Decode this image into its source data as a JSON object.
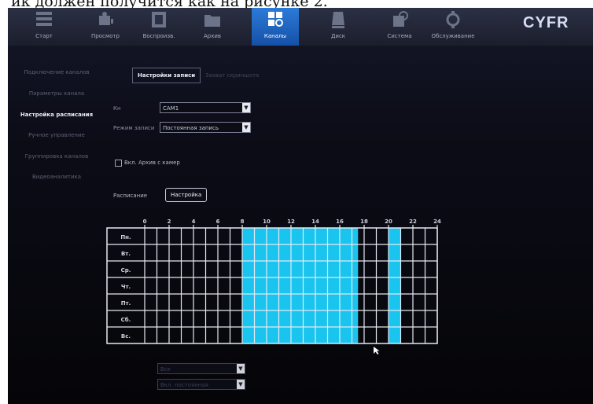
{
  "caption": "ик должен получится как на рисунке 2.",
  "brand": "CYFR",
  "menu": [
    {
      "label": "Старт",
      "icon": "start-icon",
      "active": false
    },
    {
      "label": "Просмотр",
      "icon": "view-icon",
      "active": false
    },
    {
      "label": "Воспроизв.",
      "icon": "playback-icon",
      "active": false
    },
    {
      "label": "Архив",
      "icon": "archive-icon",
      "active": false
    },
    {
      "label": "Каналы",
      "icon": "channels-icon",
      "active": true
    },
    {
      "label": "Диск",
      "icon": "disk-icon",
      "active": false
    },
    {
      "label": "Система",
      "icon": "system-icon",
      "active": false
    },
    {
      "label": "Обслуживание",
      "icon": "maintenance-icon",
      "active": false
    }
  ],
  "sidebar": [
    {
      "label": "Подключение каналов",
      "active": false
    },
    {
      "label": "Параметры канала",
      "active": false
    },
    {
      "label": "Настройка расписания",
      "active": true
    },
    {
      "label": "Ручное управление",
      "active": false
    },
    {
      "label": "Группировка каналов",
      "active": false
    },
    {
      "label": "Видеоаналитика",
      "active": false
    }
  ],
  "tabs": {
    "record": "Настройки записи",
    "snapshot": "Захват скриншота"
  },
  "form": {
    "channel_label": "Кн",
    "channel_value": "CAM1",
    "mode_label": "Режим записи",
    "mode_value": "Постоянная запись",
    "camera_archive_label": "Вкл. Архив с камер",
    "schedule_label": "Расписание",
    "setup_button": "Настройка",
    "copy_value": "Все",
    "apply_value": "Вкл. постоянная"
  },
  "schedule": {
    "hour_ticks": [
      "0",
      "2",
      "4",
      "6",
      "8",
      "10",
      "12",
      "14",
      "16",
      "18",
      "20",
      "22",
      "24"
    ],
    "days": [
      "Пн.",
      "Вт.",
      "Ср.",
      "Чт.",
      "Пт.",
      "Сб.",
      "Вс."
    ],
    "active_ranges": [
      [
        8,
        17.5
      ],
      [
        20,
        21
      ]
    ],
    "fill_color": "#19c4ee",
    "grid_color": "#e6e8f2"
  }
}
